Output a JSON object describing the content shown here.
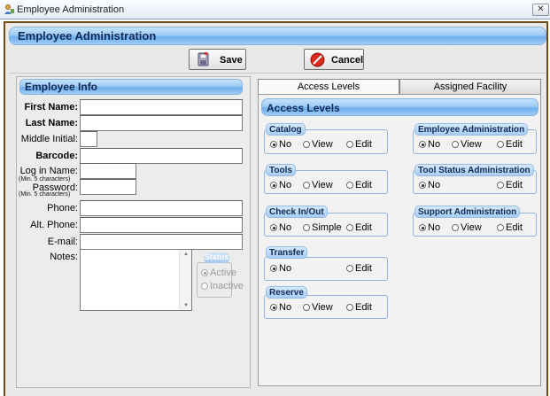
{
  "window": {
    "title": "Employee Administration",
    "close_glyph": "✕",
    "app_icon": "person-icon"
  },
  "main_header": "Employee Administration",
  "toolbar": {
    "save_label": "Save",
    "cancel_label": "Cancel"
  },
  "employee_info": {
    "header": "Employee Info",
    "first_name_label": "First Name:",
    "last_name_label": "Last Name:",
    "middle_initial_label": "Middle Initial:",
    "barcode_label": "Barcode:",
    "login_label": "Log in Name:",
    "login_hint": "(Min. 5 characters)",
    "password_label": "Password:",
    "password_hint": "(Min. 5 characters)",
    "phone_label": "Phone:",
    "alt_phone_label": "Alt. Phone:",
    "email_label": "E-mail:",
    "notes_label": "Notes:",
    "first_name": "",
    "last_name": "",
    "middle_initial": "",
    "barcode": "",
    "login": "",
    "password": "",
    "phone": "",
    "alt_phone": "",
    "email": "",
    "notes": ""
  },
  "status": {
    "title": "Status",
    "active": "Active",
    "inactive": "Inactive"
  },
  "tabs": {
    "access": "Access Levels",
    "facility": "Assigned Facility"
  },
  "access_levels": {
    "header": "Access Levels",
    "catalog": {
      "title": "Catalog",
      "opts": [
        "No",
        "View",
        "Edit"
      ]
    },
    "tools": {
      "title": "Tools",
      "opts": [
        "No",
        "View",
        "Edit"
      ]
    },
    "checkinout": {
      "title": "Check In/Out",
      "opts": [
        "No",
        "Simple",
        "Edit"
      ]
    },
    "transfer": {
      "title": "Transfer",
      "opts": [
        "No",
        "Edit"
      ]
    },
    "reserve": {
      "title": "Reserve",
      "opts": [
        "No",
        "View",
        "Edit"
      ]
    },
    "employee_admin": {
      "title": "Employee Administration",
      "opts": [
        "No",
        "View",
        "Edit"
      ]
    },
    "tool_status_admin": {
      "title": "Tool Status Administration",
      "opts": [
        "No",
        "Edit"
      ]
    },
    "support_admin": {
      "title": "Support Administration",
      "opts": [
        "No",
        "View",
        "Edit"
      ]
    }
  },
  "colors": {
    "header_blue": "#6fb0ee",
    "header_text": "#102a56",
    "frame_border": "#6b4a14",
    "cancel_red": "#d9281c"
  }
}
